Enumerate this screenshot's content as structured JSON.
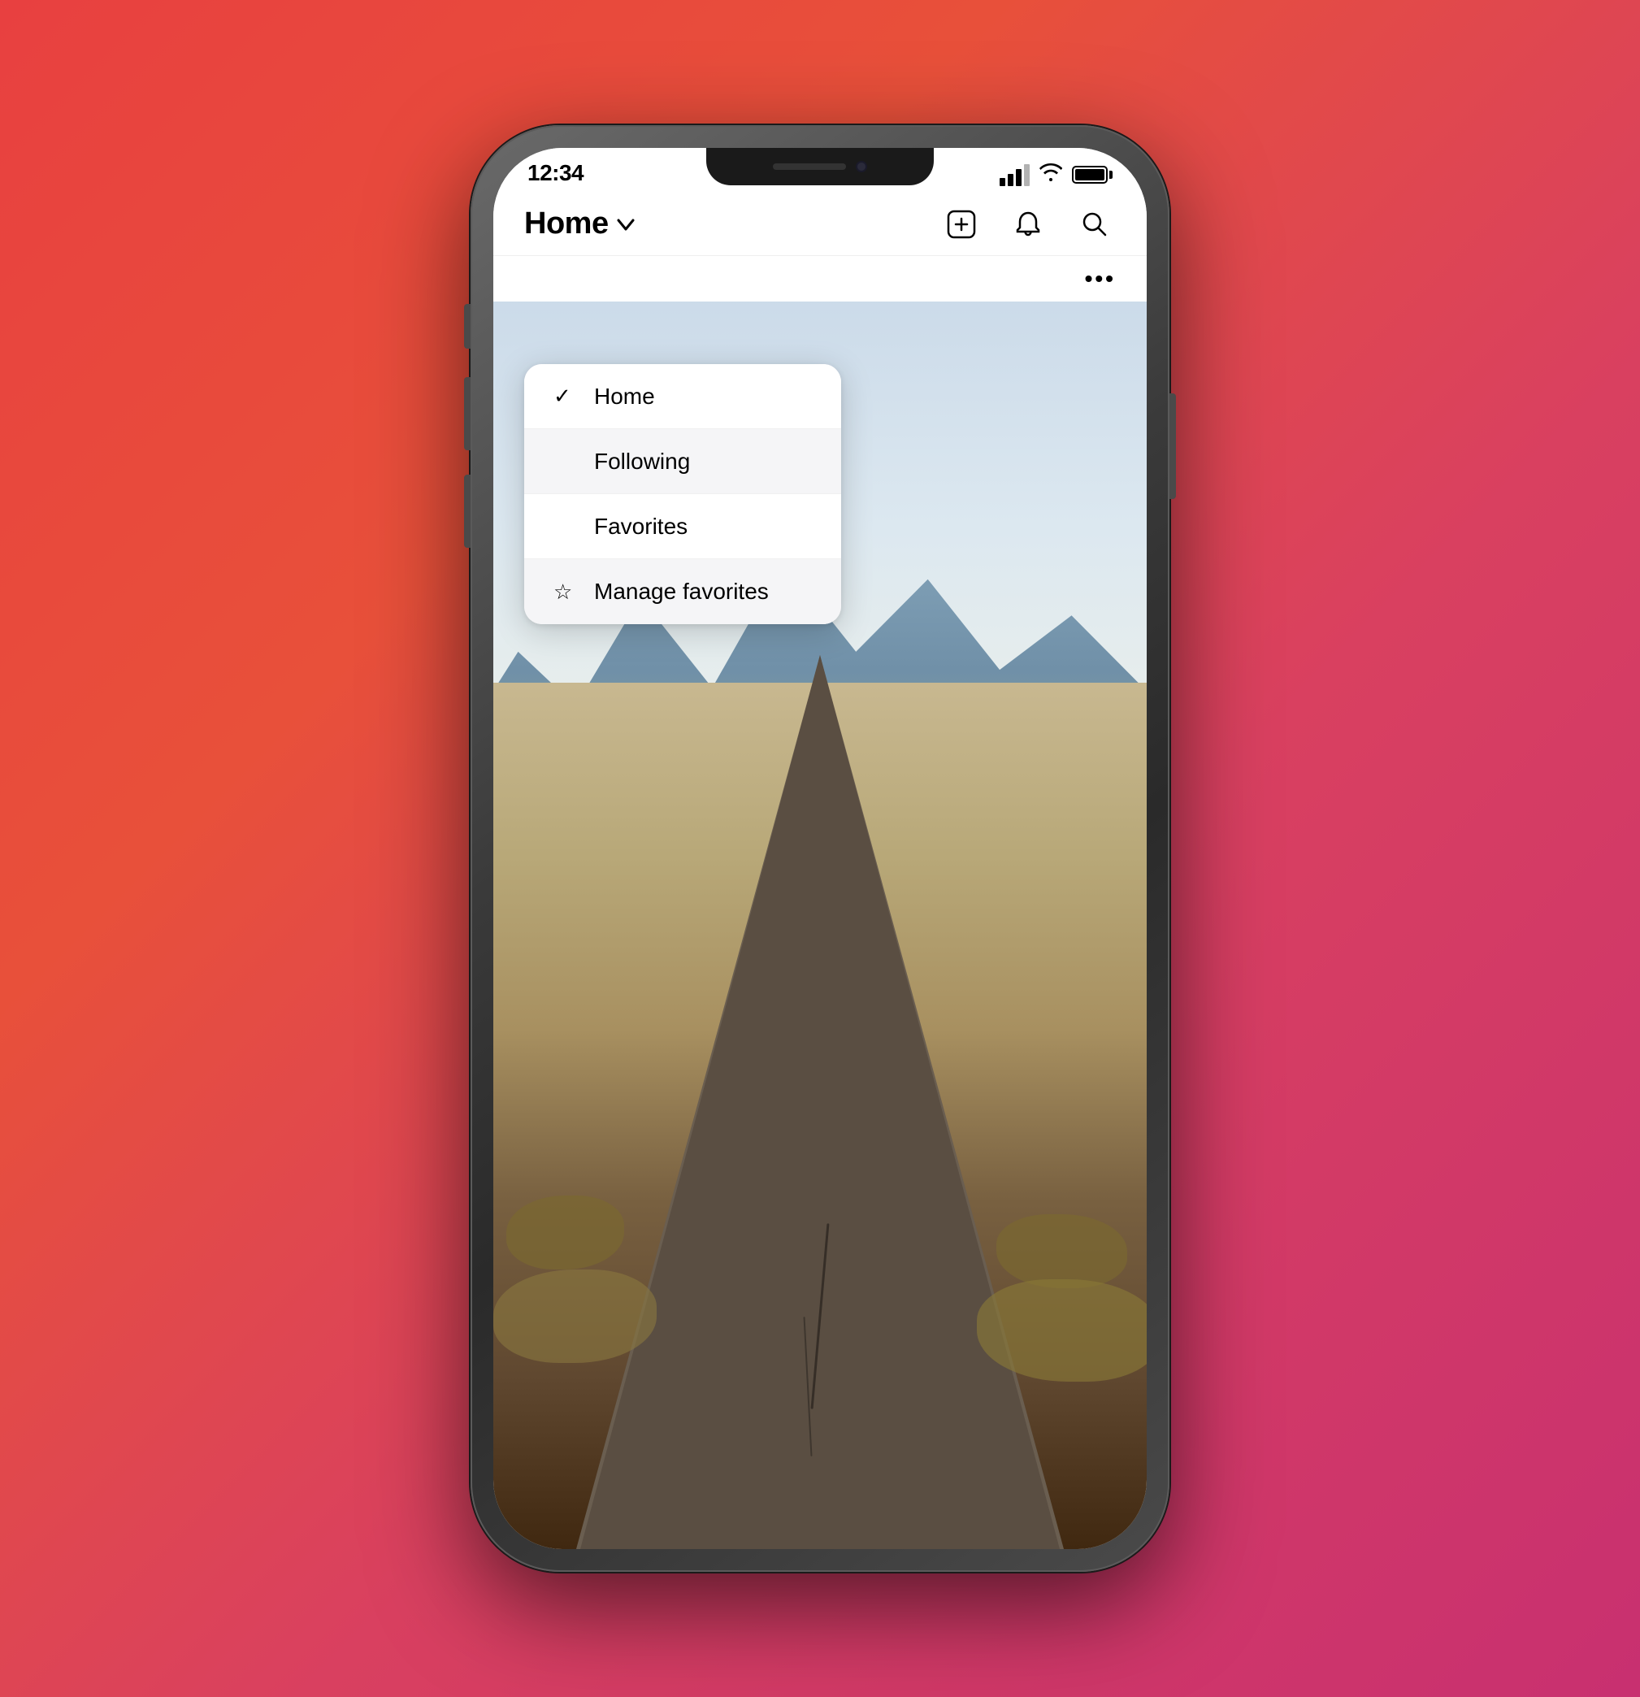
{
  "background": {
    "gradient_start": "#e84040",
    "gradient_end": "#c83070"
  },
  "status_bar": {
    "time": "12:34",
    "signal_label": "signal bars",
    "wifi_label": "wifi",
    "battery_label": "battery"
  },
  "nav_bar": {
    "title": "Home",
    "chevron": "chevron-down",
    "icons": {
      "add_label": "add post",
      "heart_label": "notifications",
      "search_label": "search"
    }
  },
  "three_dots": "•••",
  "dropdown": {
    "items": [
      {
        "label": "Home",
        "selected": true,
        "has_check": true,
        "has_star": false,
        "dimmed": false
      },
      {
        "label": "Following",
        "selected": false,
        "has_check": false,
        "has_star": false,
        "dimmed": true
      },
      {
        "label": "Favorites",
        "selected": false,
        "has_check": false,
        "has_star": false,
        "dimmed": false
      },
      {
        "label": "Manage favorites",
        "selected": false,
        "has_check": false,
        "has_star": true,
        "dimmed": false
      }
    ]
  }
}
